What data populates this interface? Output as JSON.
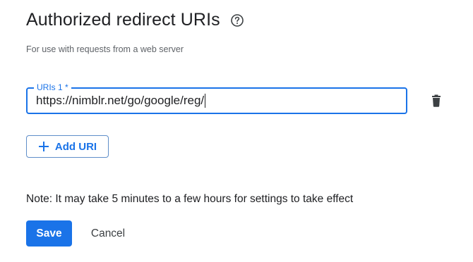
{
  "section": {
    "title": "Authorized redirect URIs",
    "subtitle": "For use with requests from a web server",
    "help_icon": "help-circle-icon"
  },
  "uri_field": {
    "label": "URIs 1 *",
    "value": "https://nimblr.net/go/google/reg/",
    "delete_icon": "trash-icon"
  },
  "add_button": {
    "icon": "plus-icon",
    "label": "Add URI"
  },
  "note": "Note: It may take 5 minutes to a few hours for settings to take effect",
  "actions": {
    "save_label": "Save",
    "cancel_label": "Cancel"
  },
  "colors": {
    "accent": "#1a73e8",
    "text": "#202124",
    "muted": "#5f6368"
  }
}
